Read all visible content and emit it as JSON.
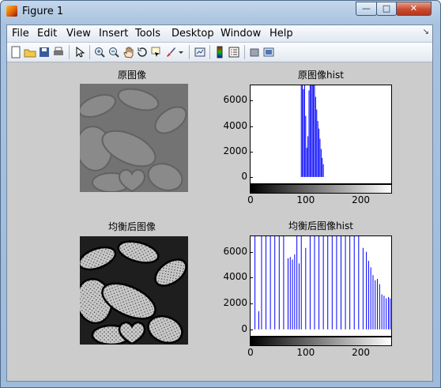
{
  "window": {
    "title": "Figure 1",
    "minimize_glyph": "—",
    "maximize_glyph": "□",
    "close_glyph": "✕"
  },
  "menu": {
    "items": [
      "File",
      "Edit",
      "View",
      "Insert",
      "Tools",
      "Desktop",
      "Window",
      "Help"
    ],
    "overflow_glyph": "↘"
  },
  "toolbar": {
    "icons": [
      "new-figure-icon",
      "open-file-icon",
      "save-figure-icon",
      "print-figure-icon",
      "edit-plot-icon",
      "zoom-in-icon",
      "zoom-out-icon",
      "pan-icon",
      "rotate-3d-icon",
      "data-cursor-icon",
      "brush-icon",
      "link-plot-icon",
      "insert-colorbar-icon",
      "insert-legend-icon",
      "hide-plot-tools-icon",
      "show-plot-tools-icon"
    ]
  },
  "panels": {
    "original_image_title": "原图像",
    "original_hist_title": "原图像hist",
    "equalized_image_title": "均衡后图像",
    "equalized_hist_title": "均衡后图像hist"
  },
  "chart_data": [
    {
      "type": "bar",
      "title": "原图像hist",
      "xlabel": "",
      "ylabel": "",
      "xlim": [
        0,
        255
      ],
      "ylim": [
        -500,
        7200
      ],
      "yticks": [
        0,
        2000,
        4000,
        6000
      ],
      "xticks": [
        0,
        100,
        200
      ],
      "color": "#0000ff",
      "x": [
        92,
        94,
        96,
        98,
        100,
        102,
        104,
        106,
        108,
        110,
        112,
        114,
        116,
        118,
        120,
        122,
        124,
        126,
        128,
        130,
        132
      ],
      "values": [
        7200,
        7200,
        6900,
        7200,
        4800,
        2300,
        3200,
        6800,
        7200,
        7200,
        7200,
        7200,
        7200,
        6300,
        5300,
        4400,
        3800,
        3000,
        2200,
        1500,
        1000
      ]
    },
    {
      "type": "bar",
      "title": "均衡后图像hist",
      "xlabel": "",
      "ylabel": "",
      "xlim": [
        0,
        255
      ],
      "ylim": [
        -500,
        7200
      ],
      "yticks": [
        0,
        2000,
        4000,
        6000
      ],
      "xticks": [
        0,
        100,
        200
      ],
      "color": "#0000ff",
      "x": [
        8,
        15,
        20,
        28,
        36,
        44,
        52,
        60,
        68,
        72,
        76,
        80,
        84,
        88,
        92,
        100,
        108,
        116,
        124,
        132,
        140,
        148,
        156,
        164,
        172,
        180,
        188,
        196,
        204,
        210,
        214,
        218,
        222,
        226,
        230,
        234,
        238,
        242,
        246,
        250,
        253
      ],
      "values": [
        7200,
        1400,
        7200,
        7200,
        7200,
        7200,
        7200,
        7200,
        5500,
        5600,
        5400,
        5800,
        7200,
        5100,
        7200,
        6300,
        7200,
        7200,
        7200,
        7200,
        7200,
        7200,
        7200,
        7200,
        7200,
        7200,
        7200,
        7200,
        6300,
        6000,
        5300,
        4800,
        4200,
        3800,
        3900,
        3500,
        2700,
        2600,
        2400,
        2500,
        2400
      ]
    }
  ]
}
